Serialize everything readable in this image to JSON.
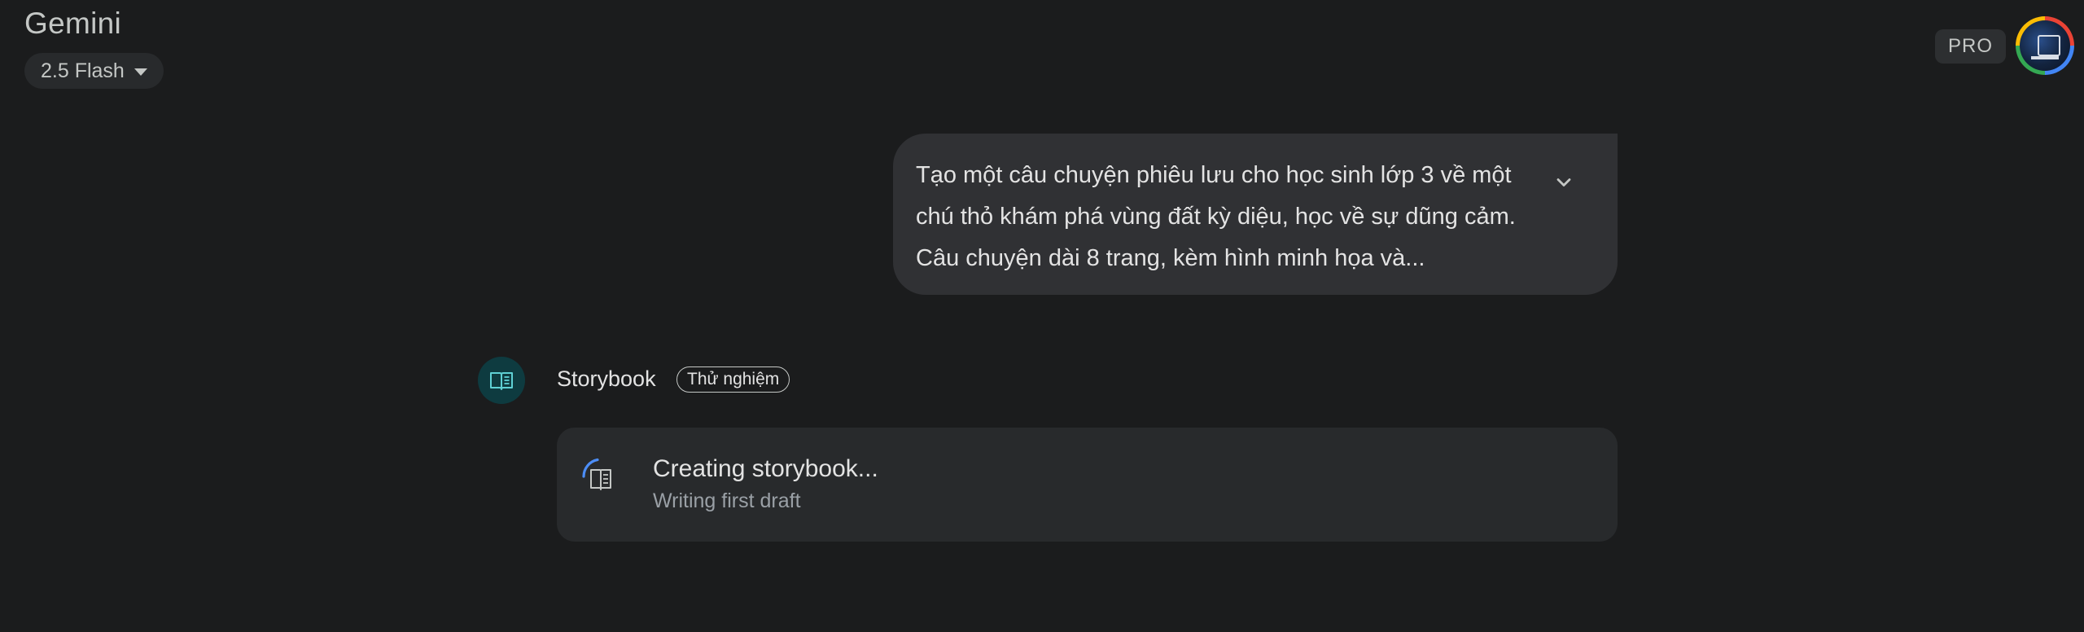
{
  "header": {
    "app_title": "Gemini",
    "model_selector": {
      "label": "2.5 Flash",
      "icon": "caret-down-icon"
    },
    "plan_badge": "PRO",
    "avatar": {
      "icon": "user-avatar-icon",
      "ring_colors": [
        "#ea4335",
        "#4285f4",
        "#34a853",
        "#fbbc04"
      ]
    }
  },
  "conversation": {
    "user_message": {
      "text": "Tạo một câu chuyện phiêu lưu cho học sinh lớp 3 về một chú thỏ khám phá vùng đất kỳ diệu, học về sự dũng cảm. Câu chuyện dài 8 trang, kèm hình minh họa và...",
      "expand_icon": "chevron-down-icon"
    },
    "response": {
      "agent_name": "Storybook",
      "agent_icon": "open-book-icon",
      "agent_badge": "Thử nghiệm",
      "status": {
        "title": "Creating storybook...",
        "subtitle": "Writing first draft",
        "icon": "book-loading-icon"
      }
    }
  },
  "colors": {
    "background": "#1b1c1d",
    "bubble": "#303134",
    "card": "#282a2c",
    "accent_teal": "#0e3b40",
    "spinner_blue": "#4c8df6"
  }
}
